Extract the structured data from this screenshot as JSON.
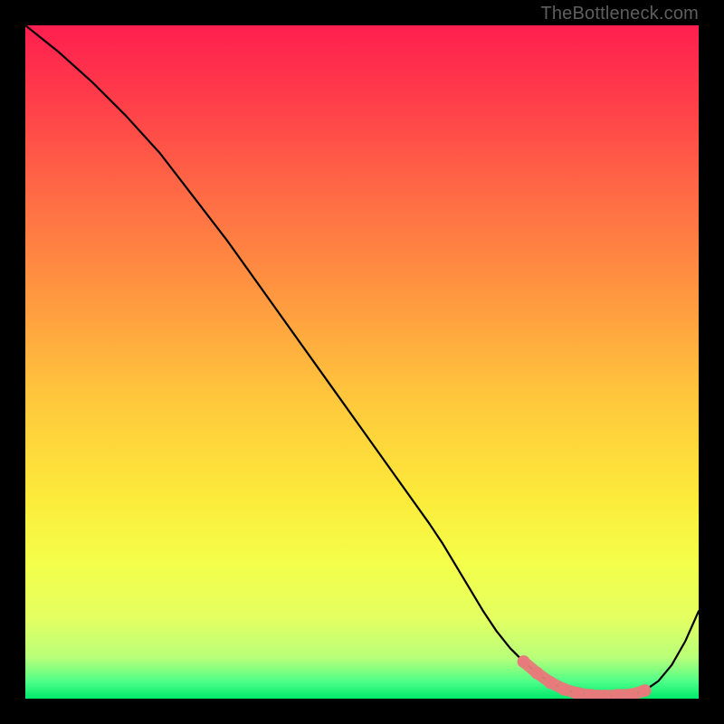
{
  "watermark": "TheBottleneck.com",
  "chart_data": {
    "type": "line",
    "title": "",
    "xlabel": "",
    "ylabel": "",
    "xlim": [
      0,
      100
    ],
    "ylim": [
      0,
      100
    ],
    "grid": false,
    "legend": false,
    "series": [
      {
        "name": "curve",
        "x": [
          0,
          5,
          10,
          15,
          20,
          25,
          30,
          35,
          40,
          45,
          50,
          55,
          60,
          62,
          65,
          68,
          70,
          72,
          74,
          76,
          78,
          80,
          82,
          84,
          85,
          86,
          88,
          90,
          92,
          94,
          96,
          98,
          100
        ],
        "y": [
          100,
          96,
          91.5,
          86.5,
          81,
          74.5,
          68,
          61,
          54,
          47,
          40,
          33,
          26,
          23,
          18,
          13,
          10,
          7.5,
          5.5,
          3.8,
          2.4,
          1.4,
          0.8,
          0.5,
          0.4,
          0.4,
          0.5,
          0.6,
          1.2,
          2.6,
          5.0,
          8.5,
          13
        ]
      }
    ],
    "highlight": {
      "name": "optimal-band",
      "color": "#e77a7a",
      "x": [
        74,
        76,
        78,
        80,
        82,
        84,
        85,
        86,
        88,
        90,
        92
      ],
      "y": [
        5.5,
        3.8,
        2.4,
        1.4,
        0.8,
        0.5,
        0.4,
        0.4,
        0.5,
        0.6,
        1.2
      ]
    },
    "gradient_stops": [
      {
        "offset": 0.0,
        "color": "#ff1f4f"
      },
      {
        "offset": 0.1,
        "color": "#ff3a4a"
      },
      {
        "offset": 0.25,
        "color": "#ff6a45"
      },
      {
        "offset": 0.4,
        "color": "#ff9740"
      },
      {
        "offset": 0.55,
        "color": "#ffc63c"
      },
      {
        "offset": 0.7,
        "color": "#fcea3a"
      },
      {
        "offset": 0.8,
        "color": "#f3ff4a"
      },
      {
        "offset": 0.88,
        "color": "#e4ff61"
      },
      {
        "offset": 0.94,
        "color": "#b7ff7a"
      },
      {
        "offset": 0.975,
        "color": "#4dff88"
      },
      {
        "offset": 1.0,
        "color": "#00e86b"
      }
    ]
  }
}
